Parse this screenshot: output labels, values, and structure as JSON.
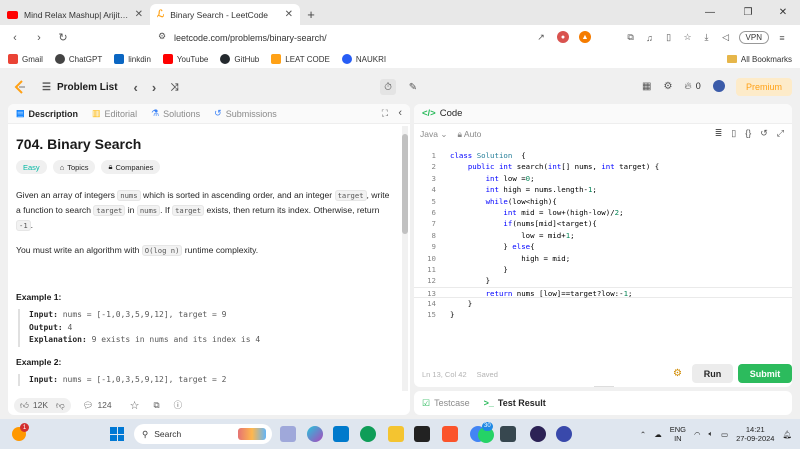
{
  "browser": {
    "tabs": [
      {
        "title": "Mind Relax Mashup| Arijit Singh",
        "active": false
      },
      {
        "title": "Binary Search - LeetCode",
        "active": true
      }
    ],
    "new_tab": "+",
    "url": "leetcode.com/problems/binary-search/",
    "vpn_label": "VPN",
    "bookmarks": [
      {
        "label": "Gmail",
        "color": "#ea4335"
      },
      {
        "label": "ChatGPT",
        "color": "#444444"
      },
      {
        "label": "linkdin",
        "color": "#0a66c2"
      },
      {
        "label": "YouTube",
        "color": "#ff0000"
      },
      {
        "label": "GitHub",
        "color": "#24292e"
      },
      {
        "label": "LEAT CODE",
        "color": "#ffa116"
      },
      {
        "label": "NAUKRI",
        "color": "#275df5"
      }
    ],
    "all_bookmarks": "All Bookmarks"
  },
  "nav": {
    "problem_list": "Problem List",
    "streak_count": "0",
    "premium": "Premium"
  },
  "left": {
    "tabs": {
      "description": "Description",
      "editorial": "Editorial",
      "solutions": "Solutions",
      "submissions": "Submissions"
    },
    "title": "704. Binary Search",
    "chips": {
      "difficulty": "Easy",
      "topics": "Topics",
      "companies": "Companies"
    },
    "statement": {
      "p1_a": "Given an array of integers ",
      "c1": "nums",
      "p1_b": " which is sorted in ascending order, and an integer ",
      "c2": "target",
      "p1_c": ", write a function to search ",
      "c3": "target",
      "p1_d": " in ",
      "c4": "nums",
      "p1_e": ". If ",
      "c5": "target",
      "p1_f": " exists, then return its index. Otherwise, return ",
      "c6": "-1",
      "p1_g": ".",
      "p2_a": "You must write an algorithm with ",
      "c7": "O(log n)",
      "p2_b": " runtime complexity."
    },
    "example1": {
      "heading": "Example 1:",
      "input_label": "Input:",
      "input": " nums = [-1,0,3,5,9,12], target = 9",
      "output_label": "Output:",
      "output": " 4",
      "expl_label": "Explanation:",
      "expl": " 9 exists in nums and its index is 4"
    },
    "example2": {
      "heading": "Example 2:",
      "input_label": "Input:",
      "input": " nums = [-1,0,3,5,9,12], target = 2"
    },
    "footer": {
      "likes": "12K",
      "comments": "124"
    }
  },
  "code": {
    "title": "Code",
    "language": "Java",
    "mode": "Auto",
    "lines": [
      {
        "n": "1",
        "parts": [
          [
            "kw",
            "class "
          ],
          [
            "ty",
            "Solution"
          ],
          [
            "",
            "  {"
          ]
        ]
      },
      {
        "n": "2",
        "parts": [
          [
            "",
            "    "
          ],
          [
            "kw",
            "public int "
          ],
          [
            "",
            "search("
          ],
          [
            "kw",
            "int"
          ],
          [
            "",
            "[] nums, "
          ],
          [
            "kw",
            "int "
          ],
          [
            "",
            "target) {"
          ]
        ]
      },
      {
        "n": "3",
        "parts": [
          [
            "",
            "        "
          ],
          [
            "kw",
            "int "
          ],
          [
            "",
            "low ="
          ],
          [
            "nm",
            "0"
          ],
          [
            "",
            ";"
          ]
        ]
      },
      {
        "n": "4",
        "parts": [
          [
            "",
            "        "
          ],
          [
            "kw",
            "int "
          ],
          [
            "",
            "high = nums.length-"
          ],
          [
            "nm",
            "1"
          ],
          [
            "",
            ";"
          ]
        ]
      },
      {
        "n": "5",
        "parts": [
          [
            "",
            "        "
          ],
          [
            "kw",
            "while"
          ],
          [
            "",
            "(low<high){"
          ]
        ]
      },
      {
        "n": "6",
        "parts": [
          [
            "",
            "            "
          ],
          [
            "kw",
            "int "
          ],
          [
            "",
            "mid = low+(high-low)/"
          ],
          [
            "nm",
            "2"
          ],
          [
            "",
            ";"
          ]
        ]
      },
      {
        "n": "7",
        "parts": [
          [
            "",
            "            "
          ],
          [
            "kw",
            "if"
          ],
          [
            "",
            "(nums[mid]<target){"
          ]
        ]
      },
      {
        "n": "8",
        "parts": [
          [
            "",
            "                low = mid+"
          ],
          [
            "nm",
            "1"
          ],
          [
            "",
            ";"
          ]
        ]
      },
      {
        "n": "9",
        "parts": [
          [
            "",
            "            } "
          ],
          [
            "kw",
            "else"
          ],
          [
            "",
            "{"
          ]
        ]
      },
      {
        "n": "10",
        "parts": [
          [
            "",
            "                high = mid;"
          ]
        ]
      },
      {
        "n": "11",
        "parts": [
          [
            "",
            "            }"
          ]
        ]
      },
      {
        "n": "12",
        "parts": [
          [
            "",
            "        }"
          ]
        ]
      },
      {
        "n": "13",
        "parts": [
          [
            "",
            "        "
          ],
          [
            "kw",
            "return "
          ],
          [
            "",
            "nums [low]==target?low:-"
          ],
          [
            "nm",
            "1"
          ],
          [
            "",
            ";"
          ]
        ]
      },
      {
        "n": "14",
        "parts": [
          [
            "",
            "    }"
          ]
        ]
      },
      {
        "n": "15",
        "parts": [
          [
            "",
            "}"
          ]
        ]
      }
    ],
    "current_line": "13",
    "cursor": "Ln 13, Col 42",
    "saved": "Saved",
    "run": "Run",
    "submit": "Submit"
  },
  "test": {
    "testcase": "Testcase",
    "result": "Test Result"
  },
  "taskbar": {
    "search": "Search",
    "lang_top": "ENG",
    "lang_bottom": "IN",
    "time": "14:21",
    "date": "27-09-2024",
    "notif_badge": "1",
    "whatsapp_badge": "30"
  }
}
